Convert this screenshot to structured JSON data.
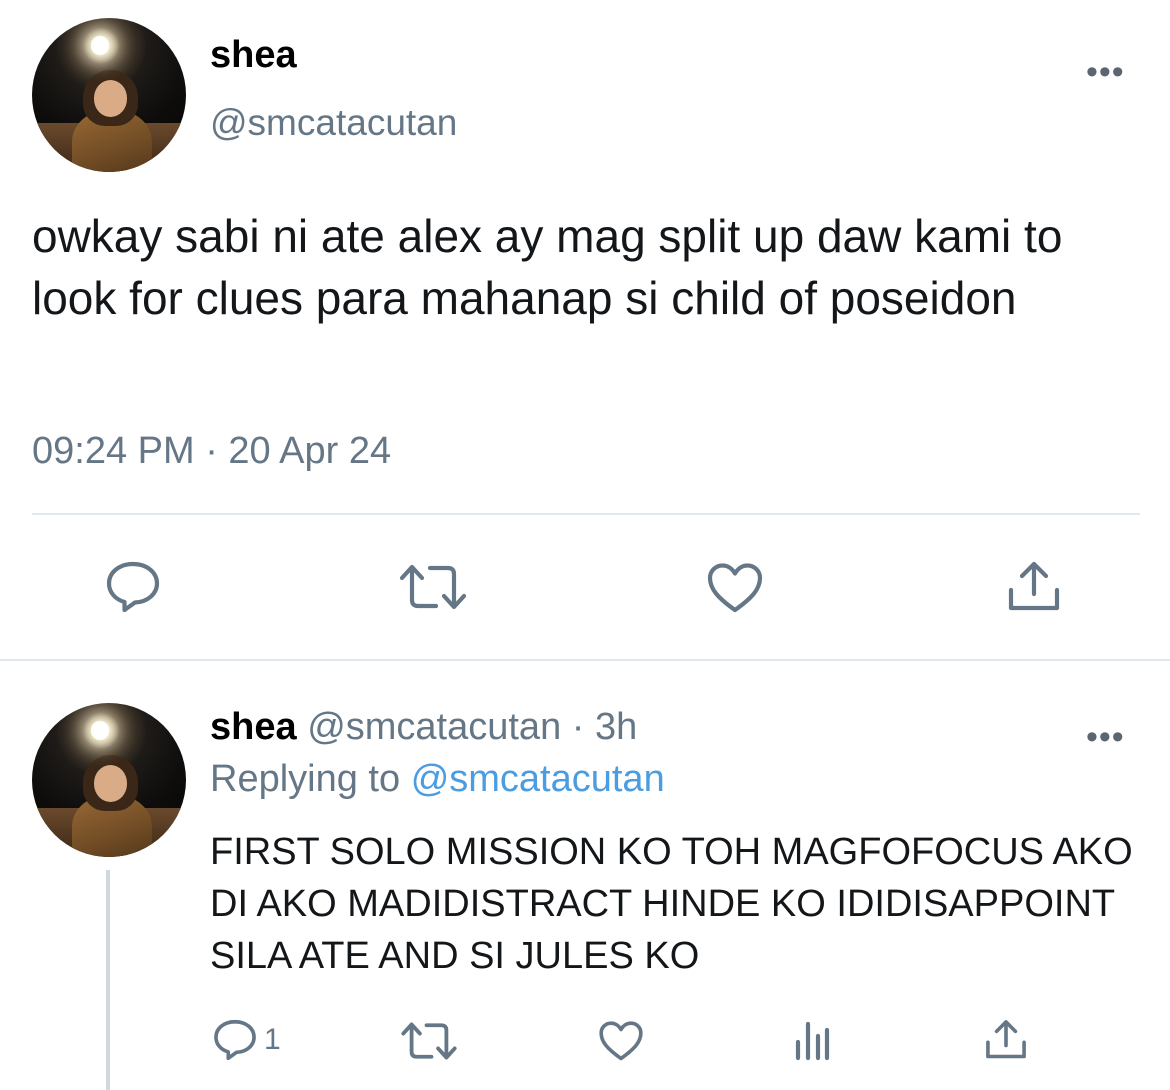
{
  "main_tweet": {
    "display_name": "shea",
    "handle": "@smcatacutan",
    "more_label": "•••",
    "text": "owkay sabi ni ate alex ay mag split up daw kami to look for clues para mahanap si child of poseidon",
    "timestamp": "09:24 PM · 20 Apr 24",
    "actions": {
      "reply_icon": "speech-bubble-icon",
      "retweet_icon": "retweet-arrows-icon",
      "like_icon": "heart-icon",
      "share_icon": "share-upload-icon"
    }
  },
  "reply_tweet": {
    "display_name": "shea",
    "handle": "@smcatacutan",
    "separator": "·",
    "time_ago": "3h",
    "more_label": "•••",
    "replying_prefix": "Replying to",
    "replying_to": "@smcatacutan",
    "text": "FIRST SOLO MISSION KO TOH MAGFOFOCUS AKO DI AKO MADIDISTRACT HINDE KO IDIDISAPPOINT SILA ATE AND SI JULES KO",
    "reply_count": "1",
    "actions": {
      "reply_icon": "speech-bubble-icon",
      "retweet_icon": "retweet-arrows-icon",
      "like_icon": "heart-icon",
      "analytics_icon": "bar-chart-icon",
      "share_icon": "share-upload-icon"
    }
  },
  "colors": {
    "secondary_text": "#657786",
    "mention": "#4a9de0",
    "divider": "#e1e8ed",
    "icon": "#657786"
  }
}
